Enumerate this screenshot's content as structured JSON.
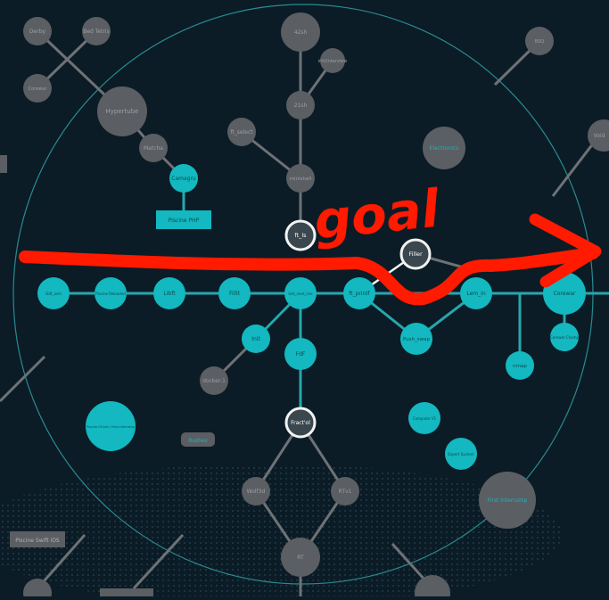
{
  "colors": {
    "background": "#0b1c26",
    "teal": "#13b8c0",
    "teal_line": "#27a7ad",
    "grey_node": "#5b5e62",
    "grey_line": "#6e7276",
    "ring": "#2a8a90",
    "white_ring": "#f2f2f2",
    "dark_core": "#26353d",
    "goal_red": "#ff1a00"
  },
  "nodes": {
    "derby": "Derby",
    "bsq": "BSQ",
    "bed_tetris": "Bed Tetris",
    "corewar": "Corewar",
    "hypertube": "Hypertube",
    "matcha": "Matcha",
    "camagru": "Camagru",
    "piscine_php": "Piscine PHP",
    "ft_select": "ft_select",
    "cash": "42sh",
    "ftsh": "21sh",
    "minishell": "minishell",
    "electronics": "Electronics",
    "init_interview": "init/interview",
    "void": "Void",
    "ft_ls": "ft_ls",
    "filler": "Filler",
    "libftasm": "libft_asm",
    "piscine_reloaded": "Piscine Reloaded",
    "libft": "Libft",
    "fillit": "Fillit",
    "get_next_line": "Get_next_line",
    "ft_printf": "ft_printf",
    "lem_in": "Lem_in",
    "corewar_right": "Corewar",
    "fdf": "FdF",
    "push_swap": "Push_swap",
    "wolf": "Wolf3d",
    "docker": "docker-1",
    "nmap": "nmap",
    "corewar_champ": "Corewar Champ",
    "fractol": "Fract'ol",
    "piscine_ocaml": "Piscine OCaml / first internship",
    "rushes": "Rushes",
    "computorv1": "Computor V1",
    "rtv1": "RTv1",
    "expert_system": "Expert System",
    "first_internship": "First Internship",
    "piscine_swift": "Piscine Swift iOS",
    "rt": "RT",
    "scop": "Scop"
  },
  "annotation": {
    "goal": "goal"
  }
}
